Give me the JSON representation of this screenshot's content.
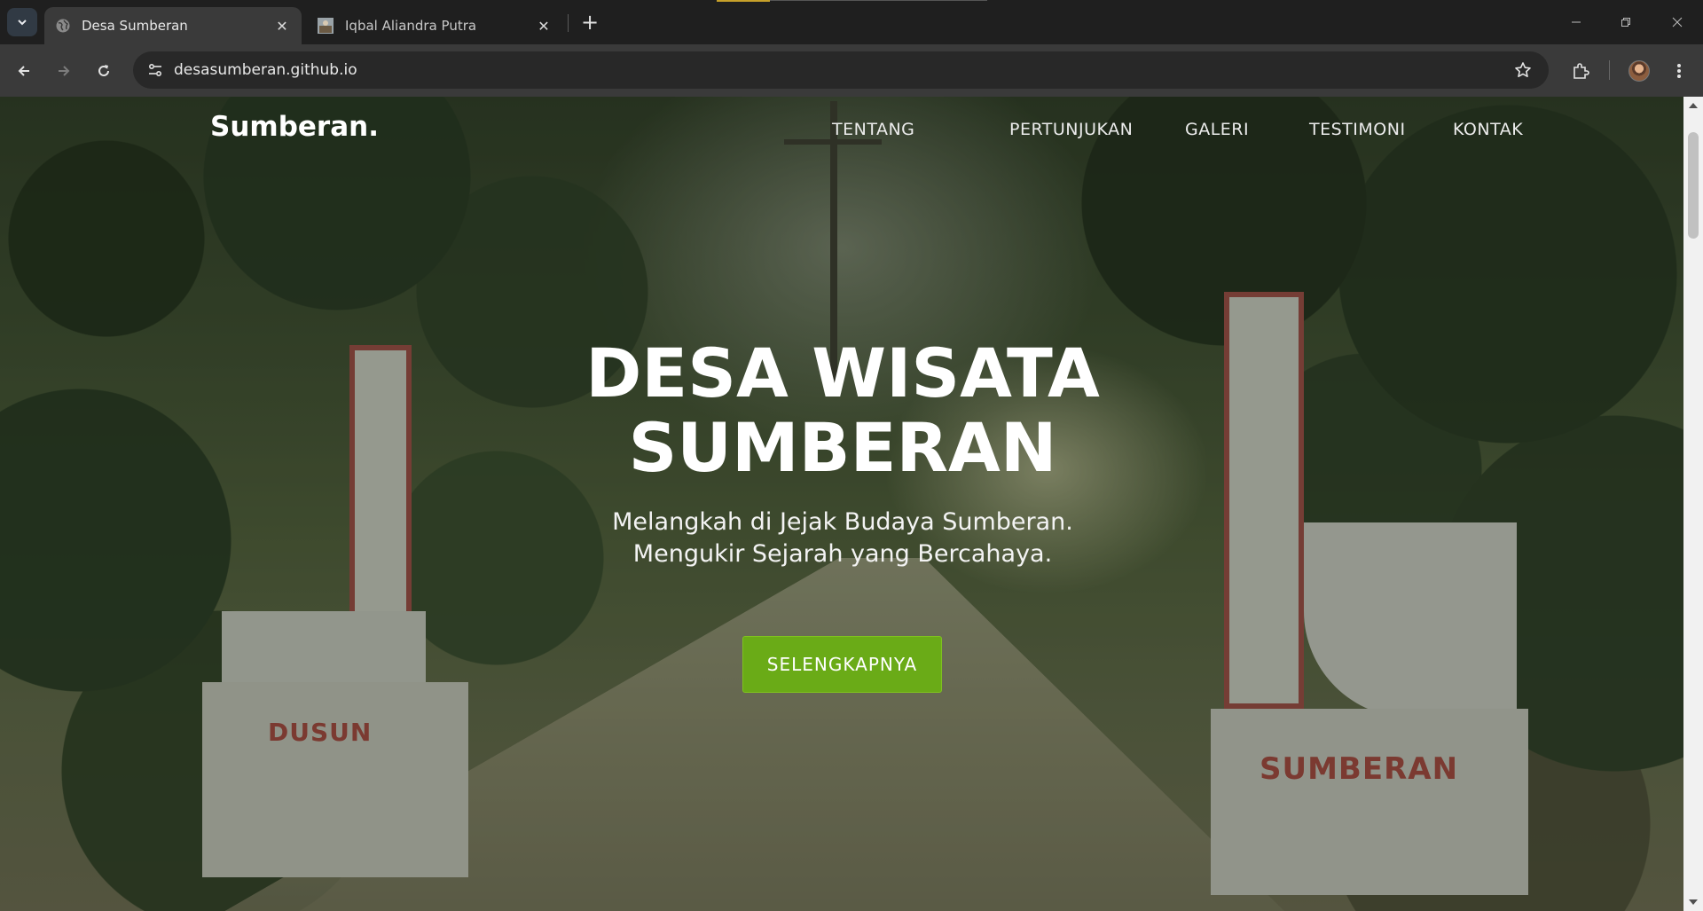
{
  "browser": {
    "tabs": [
      {
        "title": "Desa Sumberan",
        "icon": "globe-icon",
        "active": true
      },
      {
        "title": "Iqbal Aliandra Putra",
        "icon": "photo-favicon",
        "active": false
      }
    ],
    "url": "desasumberan.github.io",
    "accent": "#3a3a3a"
  },
  "site": {
    "logo": "Sumberan.",
    "nav": [
      "TENTANG",
      "PERTUNJUKAN",
      "GALERI",
      "TESTIMONI",
      "KONTAK"
    ],
    "hero": {
      "title_line1": "DESA WISATA",
      "title_line2": "SUMBERAN",
      "subtitle_line1": "Melangkah di Jejak Budaya Sumberan.",
      "subtitle_line2": "Mengukir Sejarah yang Bercahaya.",
      "cta_label": "SELENGKAPNYA",
      "cta_color": "#6aab17"
    },
    "scene_signs": {
      "left": "DUSUN",
      "right": "SUMBERAN"
    }
  }
}
